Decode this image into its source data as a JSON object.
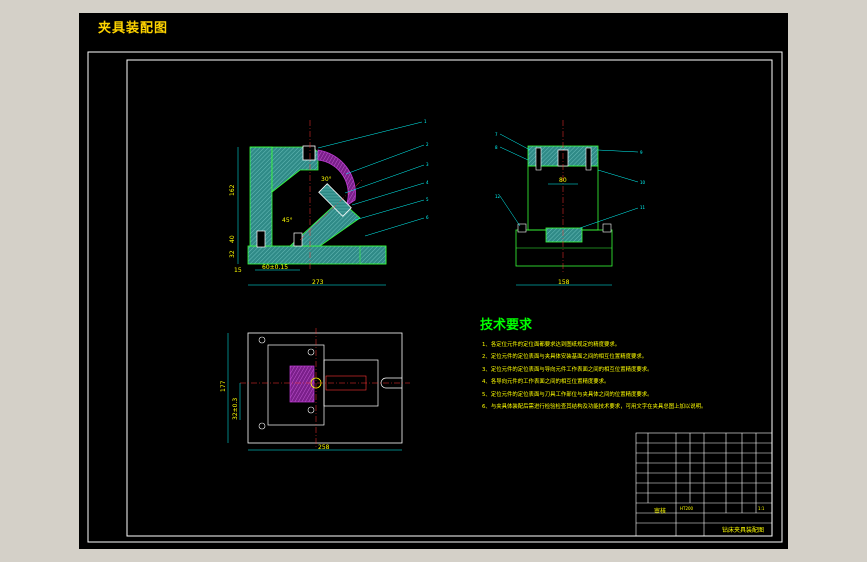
{
  "app": {
    "title": "夹具装配图"
  },
  "drawing": {
    "colors": {
      "background": "#000000",
      "frame": "#ffffff",
      "part_fill": "#2f8a87",
      "part_outline": "#39ff39",
      "hatch": "#8fe0dc",
      "dimension": "#00ffff",
      "clamp_arc": "#c13bd6",
      "leader": "#00ffff",
      "centerline": "#ff3333",
      "text_yellow": "#ffff00",
      "heading_green": "#00ff00"
    },
    "front_view": {
      "dimensions": [
        "162",
        "32",
        "40",
        "15",
        "60±0.15",
        "273"
      ],
      "angles": [
        "30°",
        "45°"
      ]
    },
    "side_view": {
      "dimensions": [
        "80",
        "158"
      ]
    },
    "top_view": {
      "dimensions": [
        "177",
        "32±0.3",
        "258"
      ]
    },
    "balloons": [
      "1",
      "2",
      "3",
      "4",
      "5",
      "6",
      "7",
      "8",
      "9",
      "10",
      "11",
      "12"
    ]
  },
  "technical_requirements": {
    "heading": "技术要求",
    "items": [
      "1、各定位元件的定位面都要求达到图纸规定的精度要求。",
      "2、定位元件的定位表面与夹具体安装基面之间的相互位置精度要求。",
      "3、定位元件的定位表面与导向元件工作表面之间的相互位置精度要求。",
      "4、各导向元件的工作表面之间的相互位置精度要求。",
      "5、定位元件的定位表面与刀具工作部位与夹具体之间的位置精度要求。",
      "6、与夹具体装配后需进行检验检查其结构及功能技术要求，可用文字在夹具总图上加以说明。"
    ]
  },
  "title_block": {
    "drawing_name": "钻床夹具装配图",
    "designer_label": "审核",
    "material_label": "HT200",
    "scale": "1:1"
  }
}
